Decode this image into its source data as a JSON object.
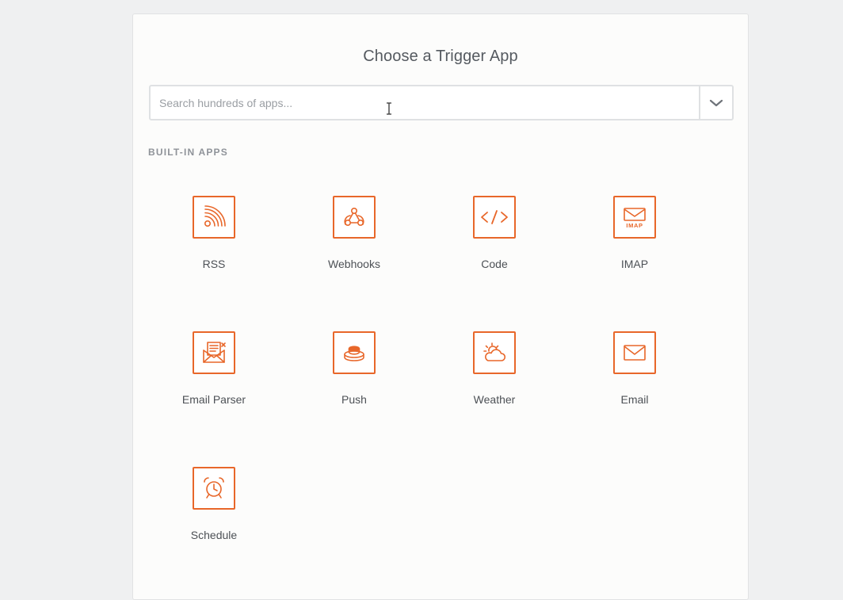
{
  "header": {
    "title": "Choose a Trigger App"
  },
  "search": {
    "placeholder": "Search hundreds of apps...",
    "value": ""
  },
  "section": {
    "label": "BUILT-IN APPS"
  },
  "theme": {
    "accent": "#e8672a",
    "background": "#eff0f1",
    "card": "#fcfcfb"
  },
  "apps": [
    {
      "label": "RSS",
      "icon": "rss-icon"
    },
    {
      "label": "Webhooks",
      "icon": "webhook-icon"
    },
    {
      "label": "Code",
      "icon": "code-icon"
    },
    {
      "label": "IMAP",
      "icon": "imap-mail-icon"
    },
    {
      "label": "Email Parser",
      "icon": "email-parser-icon"
    },
    {
      "label": "Push",
      "icon": "push-button-icon"
    },
    {
      "label": "Weather",
      "icon": "weather-icon"
    },
    {
      "label": "Email",
      "icon": "envelope-icon"
    },
    {
      "label": "Schedule",
      "icon": "alarm-clock-icon"
    }
  ]
}
